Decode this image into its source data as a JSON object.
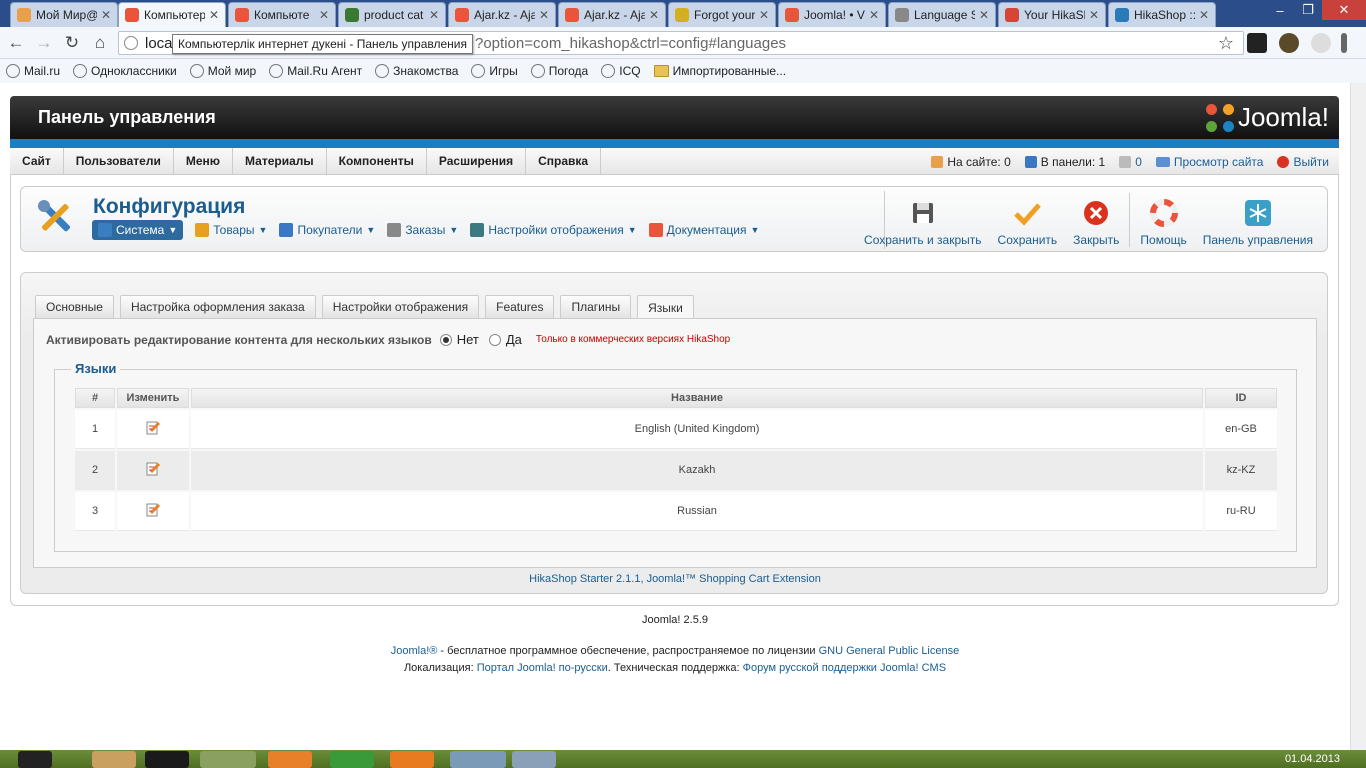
{
  "browser": {
    "tabs": [
      {
        "label": "Мой Мир@",
        "icon": "mailru-icon",
        "color": "#e8a04a"
      },
      {
        "label": "Компьютер",
        "icon": "joomla-icon",
        "color": "#e8553a",
        "active": true
      },
      {
        "label": "Компьюте",
        "icon": "joomla-icon",
        "color": "#e8553a"
      },
      {
        "label": "product cat",
        "icon": "hikashop-icon",
        "color": "#3a7a30"
      },
      {
        "label": "Ajar.kz - Aja",
        "icon": "joomla-icon",
        "color": "#e8553a"
      },
      {
        "label": "Ajar.kz - Aja",
        "icon": "joomla-icon",
        "color": "#e8553a"
      },
      {
        "label": "Forgot your",
        "icon": "forum-icon",
        "color": "#d4b020"
      },
      {
        "label": "Joomla! • Vi",
        "icon": "joomla-icon",
        "color": "#e8553a"
      },
      {
        "label": "Language S",
        "icon": "globe-icon",
        "color": "#888888"
      },
      {
        "label": "Your HikaSh",
        "icon": "gmail-icon",
        "color": "#d44638"
      },
      {
        "label": "HikaShop ::",
        "icon": "hikashop-icon",
        "color": "#2a7ab8"
      }
    ],
    "url_start": "loca",
    "url_rest": "?option=com_hikashop&ctrl=config#languages",
    "tooltip": "Компьютерлік интернет дукені - Панель управления",
    "bookmarks": [
      {
        "label": "Mail.ru",
        "type": "site"
      },
      {
        "label": "Одноклассники",
        "type": "site"
      },
      {
        "label": "Мой мир",
        "type": "site"
      },
      {
        "label": "Mail.Ru Агент",
        "type": "site"
      },
      {
        "label": "Знакомства",
        "type": "site"
      },
      {
        "label": "Игры",
        "type": "site"
      },
      {
        "label": "Погода",
        "type": "site"
      },
      {
        "label": "ICQ",
        "type": "site"
      },
      {
        "label": "Импортированные...",
        "type": "folder"
      }
    ]
  },
  "header": {
    "title": "Панель управления",
    "logo_text": "Joomla!"
  },
  "topmenu": {
    "items": [
      "Сайт",
      "Пользователи",
      "Меню",
      "Материалы",
      "Компоненты",
      "Расширения",
      "Справка"
    ],
    "status": {
      "online": "На сайте: 0",
      "in_panel": "В панели: 1",
      "messages": "0",
      "view_site": "Просмотр сайта",
      "logout": "Выйти"
    }
  },
  "config": {
    "title": "Конфигурация",
    "submenu": [
      {
        "label": "Система",
        "active": true
      },
      {
        "label": "Товары"
      },
      {
        "label": "Покупатели"
      },
      {
        "label": "Заказы"
      },
      {
        "label": "Настройки отображения"
      },
      {
        "label": "Документация"
      }
    ],
    "actions": {
      "save_close": "Сохранить и закрыть",
      "save": "Сохранить",
      "close": "Закрыть",
      "help": "Помощь",
      "dashboard": "Панель управления"
    }
  },
  "tabs": [
    "Основные",
    "Настройка оформления заказа",
    "Настройки отображения",
    "Features",
    "Плагины",
    "Языки"
  ],
  "active_tab": "Языки",
  "multilang": {
    "label": "Активировать редактирование контента для нескольких языков",
    "no": "Нет",
    "yes": "Да",
    "selected": "Нет",
    "note": "Только в коммерческих версиях HikaShop"
  },
  "languages": {
    "legend": "Языки",
    "headers": {
      "num": "#",
      "edit": "Изменить",
      "name": "Название",
      "id": "ID"
    },
    "rows": [
      {
        "num": "1",
        "name": "English (United Kingdom)",
        "id": "en-GB"
      },
      {
        "num": "2",
        "name": "Kazakh",
        "id": "kz-KZ"
      },
      {
        "num": "3",
        "name": "Russian",
        "id": "ru-RU"
      }
    ]
  },
  "footer": {
    "hikashop": "HikaShop Starter 2.1.1, Joomla!™ Shopping Cart Extension",
    "version": "Joomla! 2.5.9",
    "license_pre": "Joomla!®",
    "license_mid": " - бесплатное программное обеспечение, распространяемое по лицензии ",
    "license_link": "GNU General Public License",
    "loc_pre": "Локализация: ",
    "loc_link": "Портал Joomla! по-русски",
    "support_pre": ". Техническая поддержка: ",
    "support_link": "Форум русской поддержки Joomla! CMS"
  },
  "taskbar": {
    "clock": "01.04.2013"
  }
}
